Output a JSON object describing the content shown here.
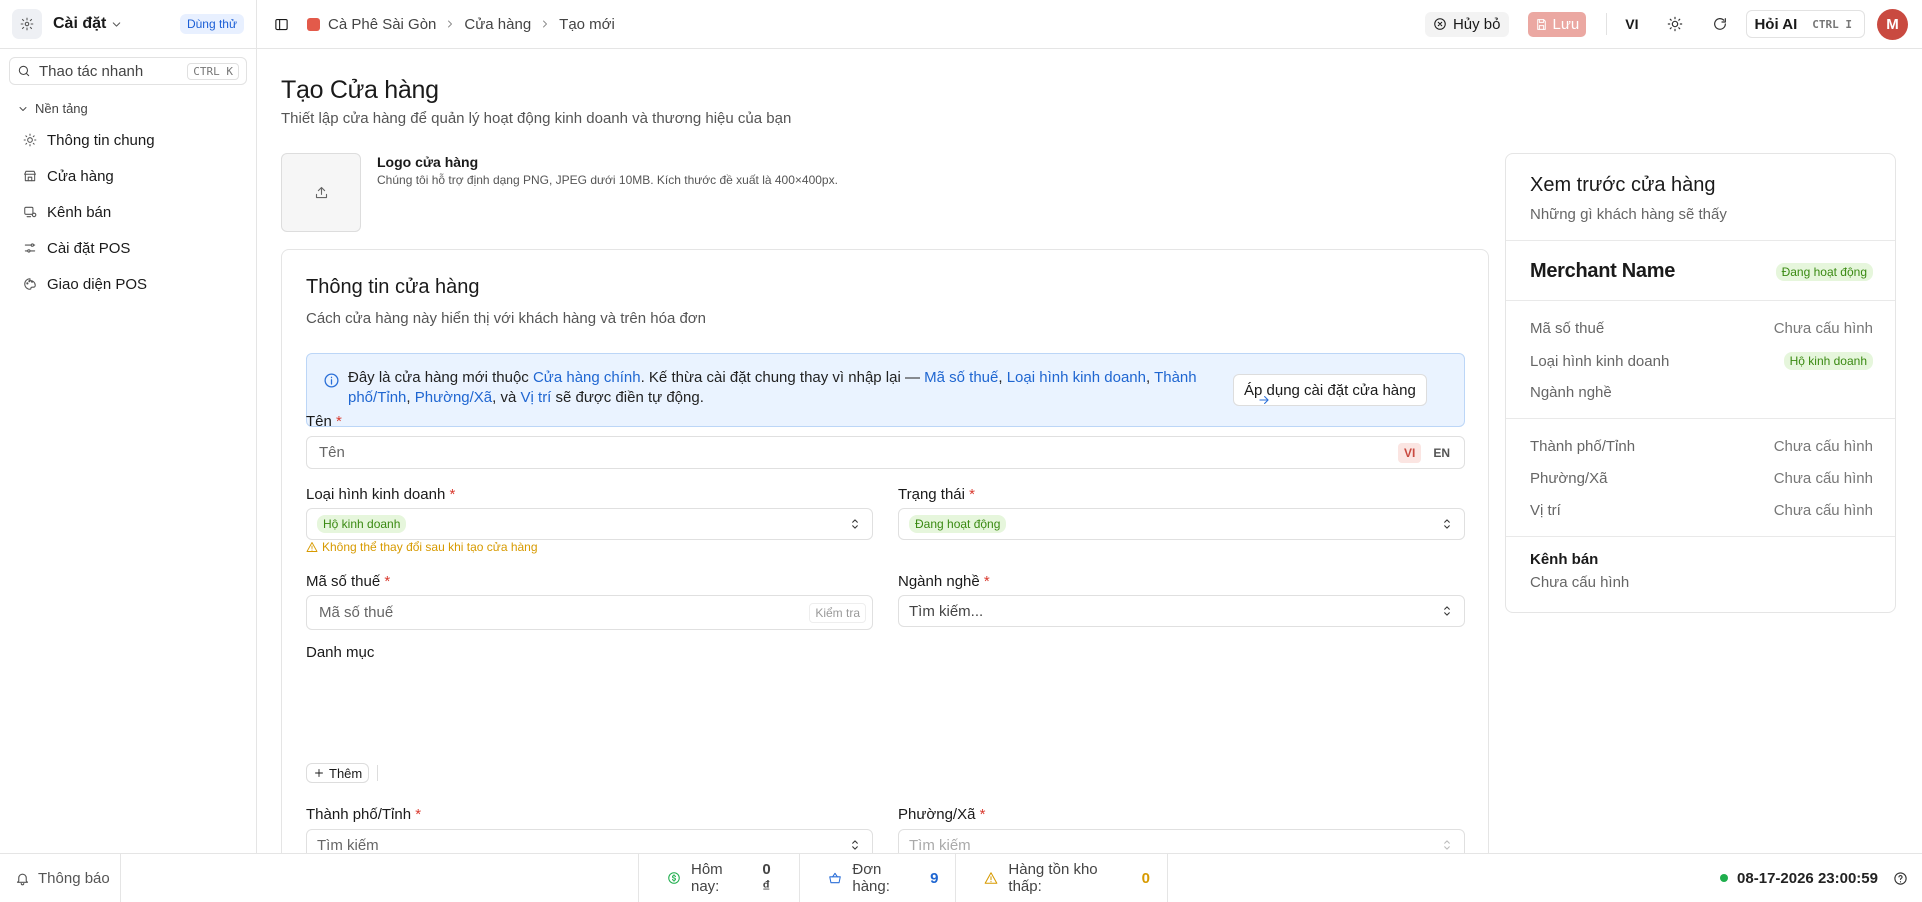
{
  "sidebar": {
    "title": "Cài đặt",
    "trial_badge": "Dùng thử",
    "search": {
      "label": "Thao tác nhanh",
      "shortcut": "CTRL K"
    },
    "section": "Nền tảng",
    "items": [
      {
        "label": "Thông tin chung",
        "icon": "sun-icon"
      },
      {
        "label": "Cửa hàng",
        "icon": "store-icon"
      },
      {
        "label": "Kênh bán",
        "icon": "channel-icon"
      },
      {
        "label": "Cài đặt POS",
        "icon": "sliders-icon"
      },
      {
        "label": "Giao diện POS",
        "icon": "palette-icon"
      }
    ]
  },
  "topbar": {
    "breadcrumb": [
      "Cà Phê Sài Gòn",
      "Cửa hàng",
      "Tạo mới"
    ],
    "cancel_label": "Hủy bỏ",
    "save_label": "Lưu",
    "language": "VI",
    "ai_label": "Hỏi AI",
    "ai_shortcut": "CTRL I",
    "avatar_initial": "M"
  },
  "page": {
    "title": "Tạo Cửa hàng",
    "subtitle": "Thiết lập cửa hàng để quản lý hoạt động kinh doanh và thương hiệu của bạn"
  },
  "logo": {
    "title": "Logo cửa hàng",
    "hint": "Chúng tôi hỗ trợ định dạng PNG, JPEG dưới 10MB. Kích thước đề xuất là 400×400px."
  },
  "card": {
    "title": "Thông tin cửa hàng",
    "subtitle": "Cách cửa hàng này hiển thị với khách hàng và trên hóa đơn",
    "notice": {
      "t1": "Đây là cửa hàng mới thuộc ",
      "l1": "Cửa hàng chính",
      "t2": ". Kế thừa cài đặt chung thay vì nhập lại — ",
      "l2": "Mã số thuế",
      "t3": ", ",
      "l3": "Loại hình kinh doanh",
      "t4": ", ",
      "l4": "Thành phố/Tỉnh",
      "t5": ", ",
      "l5": "Phường/Xã",
      "t6": ", và ",
      "l6": "Vị trí",
      "t7": " sẽ được điền tự động.",
      "button": "Áp dụng cài đặt cửa hàng"
    },
    "fields": {
      "name": {
        "label": "Tên",
        "placeholder": "Tên",
        "lang_vi": "VI",
        "lang_en": "EN"
      },
      "business_type": {
        "label": "Loại hình kinh doanh",
        "value": "Hộ kinh doanh",
        "warning": "Không thể thay đổi sau khi tạo cửa hàng"
      },
      "status": {
        "label": "Trạng thái",
        "value": "Đang hoạt động"
      },
      "tax_id": {
        "label": "Mã số thuế",
        "placeholder": "Mã số thuế",
        "verify": "Kiểm tra"
      },
      "industry": {
        "label": "Ngành nghề",
        "placeholder": "Tìm kiếm..."
      },
      "category": {
        "label": "Danh mục",
        "add": "Thêm"
      },
      "city": {
        "label": "Thành phố/Tỉnh",
        "placeholder": "Tìm kiếm"
      },
      "ward": {
        "label": "Phường/Xã",
        "placeholder": "Tìm kiếm"
      }
    },
    "required_mark": "*"
  },
  "preview": {
    "title": "Xem trước cửa hàng",
    "subtitle": "Những gì khách hàng sẽ thấy",
    "merchant_name": "Merchant Name",
    "status": "Đang hoạt động",
    "rows1": [
      {
        "label": "Mã số thuế",
        "value": "Chưa cấu hình"
      },
      {
        "label": "Loại hình kinh doanh",
        "value": "Hộ kinh doanh"
      },
      {
        "label": "Ngành nghề",
        "value": ""
      }
    ],
    "rows2": [
      {
        "label": "Thành phố/Tỉnh",
        "value": "Chưa cấu hình"
      },
      {
        "label": "Phường/Xã",
        "value": "Chưa cấu hình"
      },
      {
        "label": "Vị trí",
        "value": "Chưa cấu hình"
      }
    ],
    "channel_title": "Kênh bán",
    "channel_value": "Chưa cấu hình"
  },
  "statusbar": {
    "notifications": "Thông báo",
    "today_label": "Hôm nay:",
    "today_value": "0 ₫",
    "orders_label": "Đơn hàng:",
    "orders_value": "9",
    "low_stock_label": "Hàng tồn kho thấp:",
    "low_stock_value": "0",
    "datetime": "08-17-2026 23:00:59"
  },
  "colors": {
    "accent": "#c94a40",
    "link": "#1f66d1",
    "success": "#3a8a12",
    "warning": "#d79a00"
  }
}
